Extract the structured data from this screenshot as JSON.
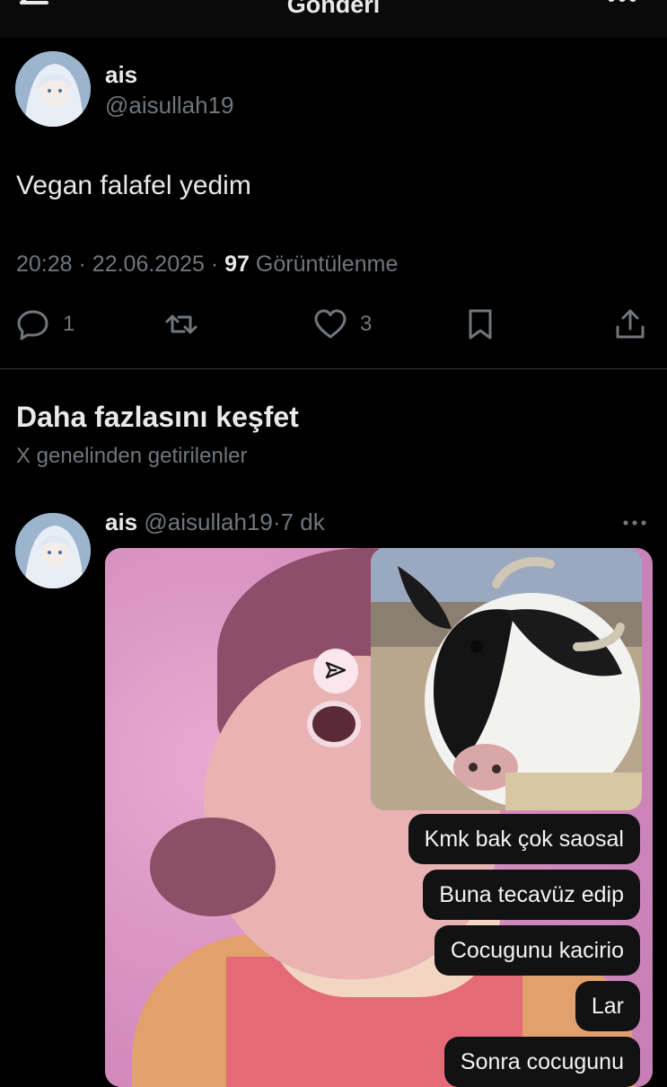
{
  "header": {
    "title": "Gönderi",
    "back_icon": "arrow-left-icon",
    "more_icon": "more-horizontal-icon"
  },
  "tweet": {
    "author_name": "ais",
    "author_handle": "@aisullah19",
    "text": "Vegan falafel yedim",
    "time": "20:28",
    "date": "22.06.2025",
    "views_count": "97",
    "views_label": "Görüntülenme",
    "replies": "1",
    "retweets": "",
    "likes": "3"
  },
  "explore": {
    "title": "Daha fazlasını keşfet",
    "subtitle": "X genelinden getirilenler"
  },
  "post": {
    "author_name": "ais",
    "author_handle": "@aisullah19",
    "age": "7 dk",
    "messages": [
      "Kmk bak çok saosal",
      "Buna tecavüz edip",
      "Cocugunu kacirio",
      "Lar",
      "Sonra cocugunu"
    ]
  },
  "colors": {
    "background": "#000000",
    "text": "#e7e9ea",
    "muted": "#71767b",
    "divider": "#2f3336",
    "media_pink": "#d896c2"
  }
}
